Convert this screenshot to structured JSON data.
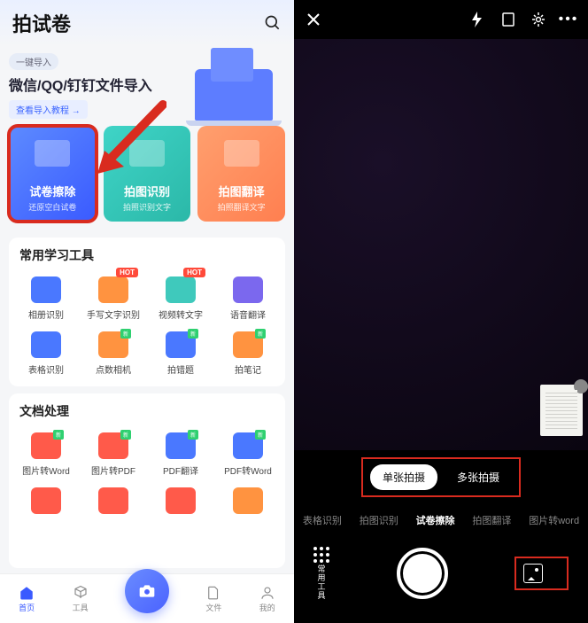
{
  "left": {
    "title": "拍试卷",
    "banner": {
      "pill": "一键导入",
      "text": "微信/QQ/钉钉文件导入",
      "link": "查看导入教程 →"
    },
    "cards": [
      {
        "t1": "试卷擦除",
        "t2": "还原空白试卷"
      },
      {
        "t1": "拍图识别",
        "t2": "拍照识别文字"
      },
      {
        "t1": "拍图翻译",
        "t2": "拍照翻译文字"
      }
    ],
    "sec1": {
      "title": "常用学习工具",
      "items": [
        {
          "label": "相册识别"
        },
        {
          "label": "手写文字识别",
          "badge": "HOT"
        },
        {
          "label": "视频转文字",
          "badge": "HOT"
        },
        {
          "label": "语音翻译"
        },
        {
          "label": "表格识别"
        },
        {
          "label": "点数相机",
          "new": true
        },
        {
          "label": "拍错题",
          "new": true
        },
        {
          "label": "拍笔记",
          "new": true
        }
      ]
    },
    "sec2": {
      "title": "文档处理",
      "items": [
        {
          "label": "图片转Word"
        },
        {
          "label": "图片转PDF"
        },
        {
          "label": "PDF翻译"
        },
        {
          "label": "PDF转Word"
        }
      ]
    },
    "tabs": [
      {
        "label": "首页"
      },
      {
        "label": "工具"
      },
      {
        "label": "文件"
      },
      {
        "label": "我的"
      }
    ]
  },
  "right": {
    "shotmodes": {
      "single": "单张拍摄",
      "multi": "多张拍摄"
    },
    "modes": [
      "表格识别",
      "拍图识别",
      "试卷擦除",
      "拍图翻译",
      "图片转word"
    ],
    "toolbox": "常用工具",
    "gallery": "图库"
  }
}
